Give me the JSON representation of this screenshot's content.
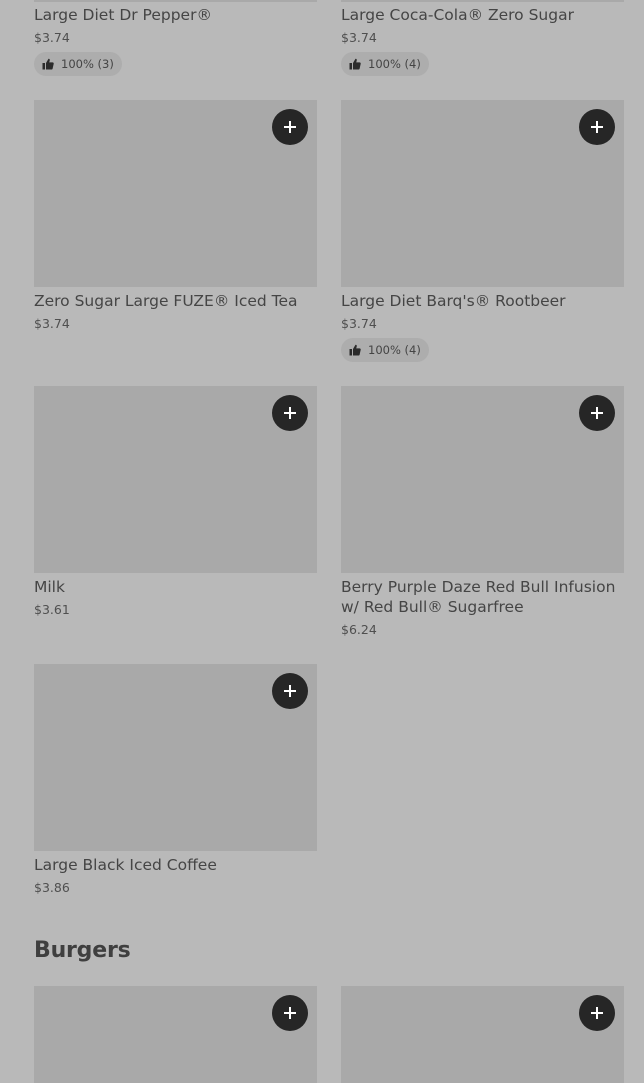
{
  "items": [
    {
      "id": "large-diet-dr-pepper",
      "title": "Large Diet Dr Pepper®",
      "price": "$3.74",
      "rating": "100% (3)"
    },
    {
      "id": "large-coca-cola-zero-sugar",
      "title": "Large Coca-Cola® Zero Sugar",
      "price": "$3.74",
      "rating": "100% (4)"
    },
    {
      "id": "zero-sugar-large-fuze-iced-tea",
      "title": "Zero Sugar Large FUZE® Iced Tea",
      "price": "$3.74"
    },
    {
      "id": "large-diet-barqs-rootbeer",
      "title": "Large Diet Barq's® Rootbeer",
      "price": "$3.74",
      "rating": "100% (4)"
    },
    {
      "id": "milk",
      "title": "Milk",
      "price": "$3.61"
    },
    {
      "id": "berry-purple-daze-red-bull",
      "title": "Berry Purple Daze Red Bull Infusion w/ Red Bull® Sugarfree",
      "price": "$6.24"
    },
    {
      "id": "large-black-iced-coffee",
      "title": "Large Black Iced Coffee",
      "price": "$3.86"
    }
  ],
  "sections": {
    "burgers": {
      "title": "Burgers"
    }
  },
  "icons": {
    "add": "plus-icon",
    "rating": "thumbs-up-icon"
  },
  "colors": {
    "background": "#b9b9b9",
    "image_placeholder": "#a9a9a9",
    "add_button": "#262626",
    "rating_pill": "#adadad"
  }
}
